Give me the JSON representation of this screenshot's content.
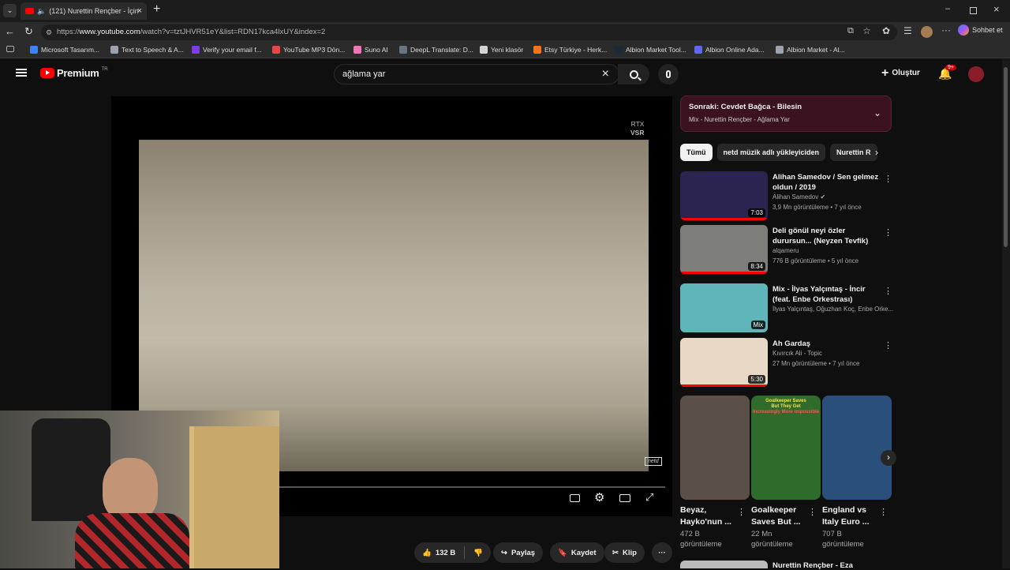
{
  "browser": {
    "tab_title": "(121) Nurettin Rençber - İçin",
    "url_prefix": "https://",
    "url_host": "www.youtube.com",
    "url_path": "/watch?v=tztJHVR51eY&list=RDN17kca4lxUY&index=2",
    "copilot_label": "Sohbet et"
  },
  "bookmarks": [
    {
      "label": "Microsoft Tasarım...",
      "color": "#3b82f6"
    },
    {
      "label": "Text to Speech & A...",
      "color": "#9ca3af"
    },
    {
      "label": "Verify your email f...",
      "color": "#7c3aed"
    },
    {
      "label": "YouTube MP3 Dön...",
      "color": "#ef4444"
    },
    {
      "label": "Suno AI",
      "color": "#f472b6"
    },
    {
      "label": "DeepL Translate: D...",
      "color": "#6b7280"
    },
    {
      "label": "Yeni klasör",
      "color": "#d4d4d4"
    },
    {
      "label": "Etsy Türkiye - Herk...",
      "color": "#f97316"
    },
    {
      "label": "Albion Market Tool...",
      "color": "#1f2937"
    },
    {
      "label": "Albion Online Ada...",
      "color": "#6366f1"
    },
    {
      "label": "Albion Market - Al...",
      "color": "#9ca3af"
    }
  ],
  "youtube": {
    "logo_text": "Premium",
    "logo_region": "TR",
    "search_value": "ağlama yar",
    "create_label": "Oluştur",
    "notif_count": "9+"
  },
  "player": {
    "badge_line1": "RTX",
    "badge_line2": "VSR",
    "watermark": "netd"
  },
  "up_next": {
    "title_prefix": "Sonraki:",
    "title": "Cevdet Bağca - Bilesin",
    "subtitle": "Mix - Nurettin Rençber - Ağlama Yar"
  },
  "chips": [
    "Tümü",
    "netd müzik adlı yükleyiciden",
    "Nurettin R"
  ],
  "videos": [
    {
      "title": "Alihan Samedov / Sen gelmez oldun / 2019",
      "channel": "Alihan Samedov",
      "verified": "✔",
      "meta": "3,9 Mn görüntüleme • 7 yıl önce",
      "duration": "7:03",
      "progress": 100,
      "thumb": "#2b2450"
    },
    {
      "title": "Deli gönül neyi özler durursun... (Neyzen Tevfik)",
      "channel": "alqameru",
      "verified": "",
      "meta": "776 B görüntüleme • 5 yıl önce",
      "duration": "8:34",
      "progress": 100,
      "thumb": "#7d7d7a"
    },
    {
      "title": "Mix - İlyas Yalçıntaş - İncir (feat. Enbe Orkestrası)",
      "channel": "İlyas Yalçıntaş, Oğuzhan Koç, Enbe Orke...",
      "verified": "",
      "meta": "",
      "duration": "Mix",
      "progress": 0,
      "thumb": "#5fb5b8"
    },
    {
      "title": "Ah Gardaş",
      "channel": "Kıvırcık Ali - Topic",
      "verified": "",
      "meta": "27 Mn görüntüleme • 7 yıl önce",
      "duration": "5:30",
      "progress": 100,
      "thumb": "#e8d9c6"
    }
  ],
  "shorts": [
    {
      "title": "Beyaz, Hayko'nun ...",
      "views": "472 B",
      "views_label": "görüntüleme",
      "color": "#5a5048"
    },
    {
      "title": "Goalkeeper Saves But ...",
      "views": "22 Mn",
      "views_label": "görüntüleme",
      "color": "#2f6b2a"
    },
    {
      "title": "England vs Italy Euro ...",
      "views": "707 B",
      "views_label": "görüntüleme",
      "color": "#2a4f7a"
    }
  ],
  "shorts_overlay": {
    "line1": "Goalkeeper Saves",
    "line2": "But They Get",
    "line3": "Increasingly More Impossible"
  },
  "actions": {
    "likes": "132 B",
    "share": "Paylaş",
    "save": "Kaydet",
    "clip": "Klip"
  },
  "partial_next": "Nurettin Rençber - Eza"
}
